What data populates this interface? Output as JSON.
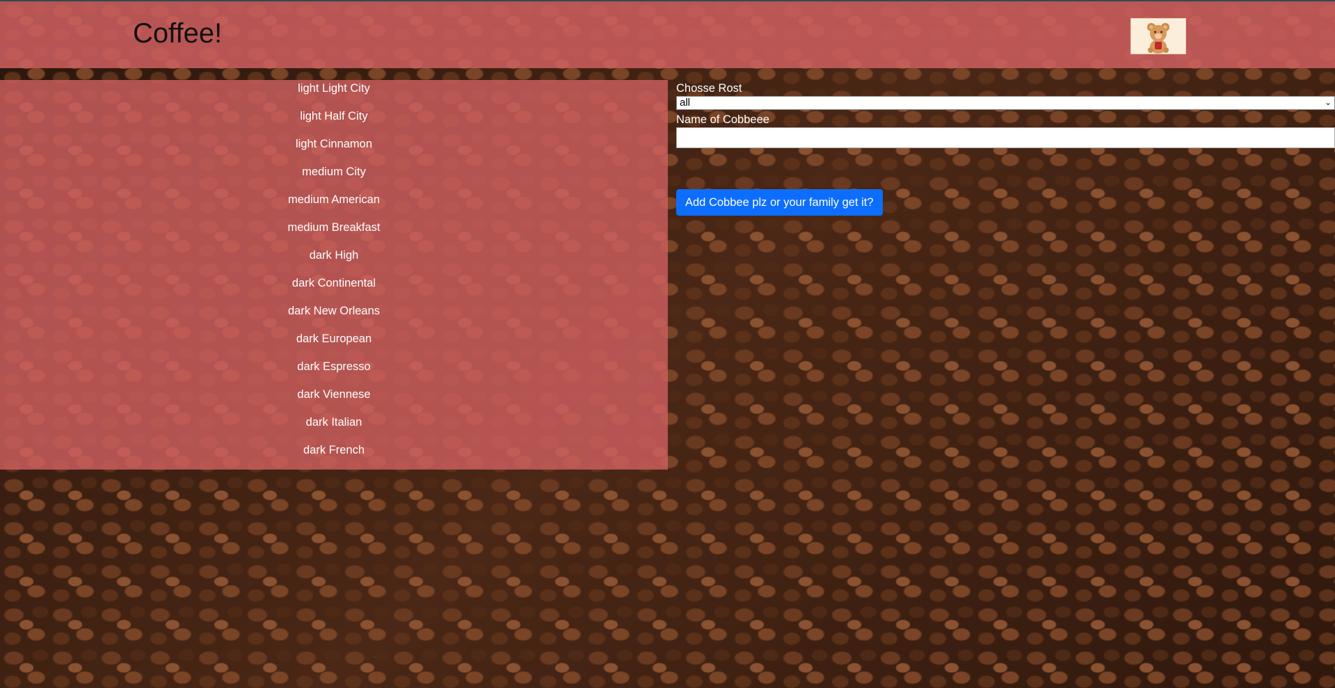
{
  "header": {
    "title": "Coffee!",
    "logo_icon": "teddy-bear-logo"
  },
  "coffees": [
    "light Light City",
    "light Half City",
    "light Cinnamon",
    "medium City",
    "medium American",
    "medium Breakfast",
    "dark High",
    "dark Continental",
    "dark New Orleans",
    "dark European",
    "dark Espresso",
    "dark Viennese",
    "dark Italian",
    "dark French"
  ],
  "form": {
    "roast_label": "Chosse Rost",
    "roast_selected": "all",
    "name_label": "Name of Cobbeee",
    "name_value": "",
    "submit_label": "Add Cobbee plz or your family get it?"
  },
  "colors": {
    "panel": "#cd5f5f",
    "button": "#0d6efd",
    "background": "#3b2114"
  }
}
